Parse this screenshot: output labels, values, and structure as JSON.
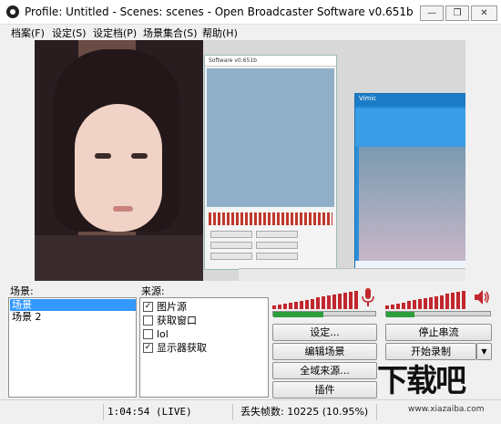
{
  "window": {
    "title": "Profile: Untitled - Scenes: scenes - Open Broadcaster Software v0.651b",
    "min": "—",
    "max": "❐",
    "close": "✕"
  },
  "menu": [
    "档案(F)",
    "设定(S)",
    "设定档(P)",
    "场景集合(S)",
    "帮助(H)"
  ],
  "preview": {
    "nested_title": "Software v0.651b",
    "qq_title": "Vimic"
  },
  "scenes": {
    "label": "场景:",
    "items": [
      {
        "label": "场景",
        "selected": true
      },
      {
        "label": "场景 2",
        "selected": false
      }
    ]
  },
  "sources": {
    "label": "来源:",
    "items": [
      {
        "label": "图片源",
        "checked": true
      },
      {
        "label": "获取窗口",
        "checked": false
      },
      {
        "label": "lol",
        "checked": false
      },
      {
        "label": "显示器获取",
        "checked": true
      }
    ]
  },
  "audio": {
    "mic_icon": "microphone-icon",
    "speaker_icon": "speaker-icon",
    "mic_level": 0.5,
    "desktop_level": 0.28,
    "mic_volume": 1.0,
    "desktop_volume": 1.0
  },
  "buttons": {
    "settings": "设定...",
    "stop_stream": "停止串流",
    "edit_scene": "编辑场景",
    "start_recording": "开始录制",
    "dropdown": "▼",
    "global_sources": "全域来源...",
    "plugins": "插件"
  },
  "status": {
    "time": "1:04:54 (LIVE)",
    "dropped_frames": "丢失帧数: 10225 (10.95%)"
  },
  "watermark": {
    "logo": "下载吧",
    "url": "www.xiazaiba.com"
  },
  "colors": {
    "selection": "#3399ff",
    "meter_red": "#c1272d",
    "level_green": "#2e9e3c"
  }
}
